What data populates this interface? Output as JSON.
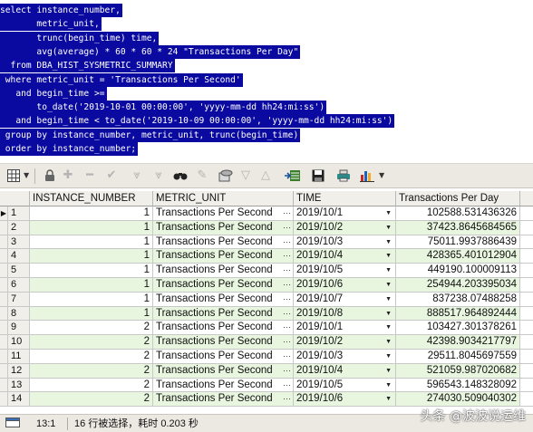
{
  "sql": {
    "lines": [
      "select instance_number,",
      "       metric_unit,",
      "       trunc(begin_time) time,",
      "       avg(average) * 60 * 60 * 24 \"Transactions Per Day\"",
      "  from DBA_HIST_SYSMETRIC_SUMMARY",
      " where metric_unit = 'Transactions Per Second'",
      "   and begin_time >=",
      "       to_date('2019-10-01 00:00:00', 'yyyy-mm-dd hh24:mi:ss')",
      "   and begin_time < to_date('2019-10-09 00:00:00', 'yyyy-mm-dd hh24:mi:ss')",
      " group by instance_number, metric_unit, trunc(begin_time)",
      " order by instance_number;"
    ]
  },
  "toolbar": {
    "icons": [
      "grid-icon",
      "lock-icon",
      "add-record-icon",
      "delete-record-icon",
      "post-icon",
      "fetch-next-icon",
      "fetch-all-icon",
      "find-icon",
      "clear-icon",
      "query-icon",
      "prev-icon",
      "next-icon",
      "export-icon",
      "save-icon",
      "print-icon",
      "chart-icon"
    ]
  },
  "grid": {
    "columns": [
      "INSTANCE_NUMBER",
      "METRIC_UNIT",
      "TIME",
      "Transactions Per Day"
    ],
    "rows": [
      {
        "n": "1",
        "inst": "1",
        "metric": "Transactions Per Second",
        "time": "2019/10/1",
        "tpd": "102588.531436326"
      },
      {
        "n": "2",
        "inst": "1",
        "metric": "Transactions Per Second",
        "time": "2019/10/2",
        "tpd": "37423.8645684565"
      },
      {
        "n": "3",
        "inst": "1",
        "metric": "Transactions Per Second",
        "time": "2019/10/3",
        "tpd": "75011.9937886439"
      },
      {
        "n": "4",
        "inst": "1",
        "metric": "Transactions Per Second",
        "time": "2019/10/4",
        "tpd": "428365.401012904"
      },
      {
        "n": "5",
        "inst": "1",
        "metric": "Transactions Per Second",
        "time": "2019/10/5",
        "tpd": "449190.100009113"
      },
      {
        "n": "6",
        "inst": "1",
        "metric": "Transactions Per Second",
        "time": "2019/10/6",
        "tpd": "254944.203395034"
      },
      {
        "n": "7",
        "inst": "1",
        "metric": "Transactions Per Second",
        "time": "2019/10/7",
        "tpd": "837238.07488258"
      },
      {
        "n": "8",
        "inst": "1",
        "metric": "Transactions Per Second",
        "time": "2019/10/8",
        "tpd": "888517.964892444"
      },
      {
        "n": "9",
        "inst": "2",
        "metric": "Transactions Per Second",
        "time": "2019/10/1",
        "tpd": "103427.301378261"
      },
      {
        "n": "10",
        "inst": "2",
        "metric": "Transactions Per Second",
        "time": "2019/10/2",
        "tpd": "42398.9034217797"
      },
      {
        "n": "11",
        "inst": "2",
        "metric": "Transactions Per Second",
        "time": "2019/10/3",
        "tpd": "29511.8045697559"
      },
      {
        "n": "12",
        "inst": "2",
        "metric": "Transactions Per Second",
        "time": "2019/10/4",
        "tpd": "521059.987020682"
      },
      {
        "n": "13",
        "inst": "2",
        "metric": "Transactions Per Second",
        "time": "2019/10/5",
        "tpd": "596543.148328092"
      },
      {
        "n": "14",
        "inst": "2",
        "metric": "Transactions Per Second",
        "time": "2019/10/6",
        "tpd": "274030.509040302"
      }
    ]
  },
  "status": {
    "position": "13:1",
    "message": "16 行被选择，耗时 0.203 秒",
    "watermark": "头条 @波波说运维"
  },
  "colors": {
    "sql_selection": "#0a0aa0",
    "alt_row": "#e8f5df"
  }
}
